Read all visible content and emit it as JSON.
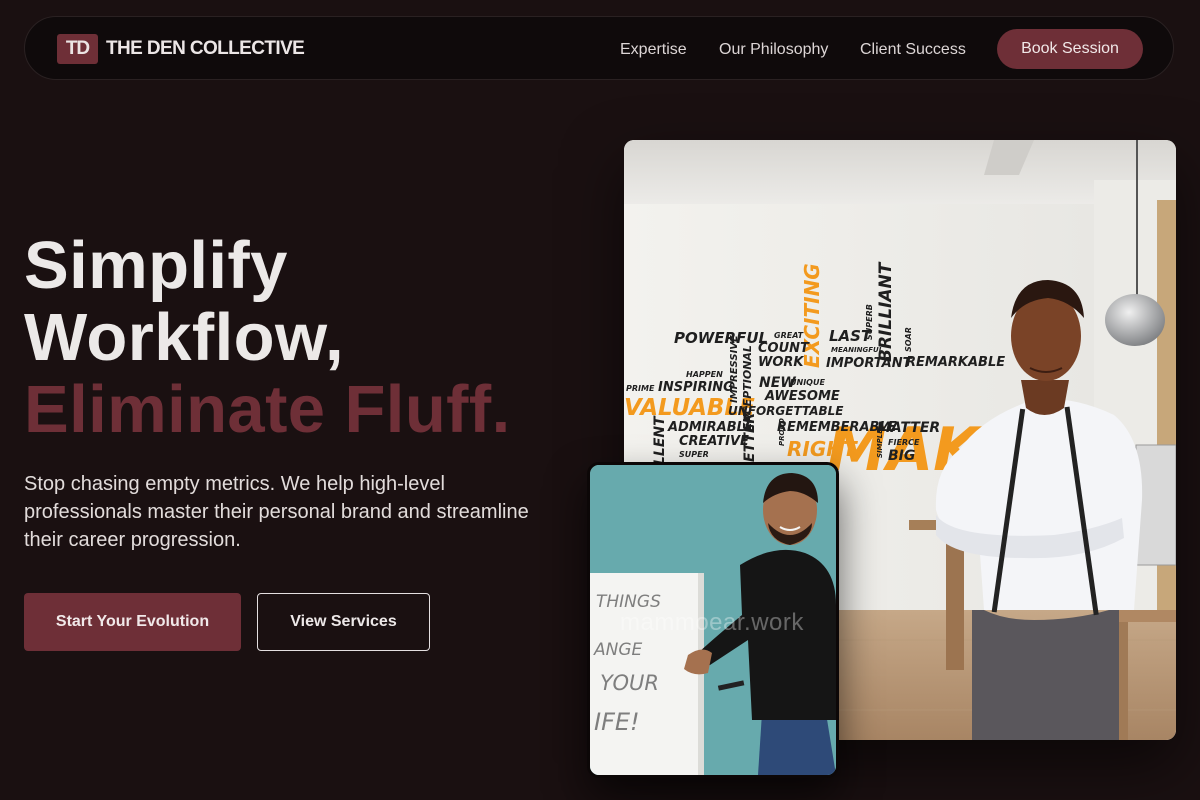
{
  "brand": {
    "badge": "TD",
    "name": "THE DEN COLLECTIVE"
  },
  "nav": {
    "links": [
      "Expertise",
      "Our Philosophy",
      "Client Success"
    ],
    "cta": "Book Session"
  },
  "hero": {
    "headline": [
      "Simplify",
      "Workflow,",
      "Eliminate Fluff."
    ],
    "subtext": "Stop chasing empty metrics. We help high-level professionals master their personal brand and streamline their career progression.",
    "primary_button": "Start Your Evolution",
    "secondary_button": "View Services"
  },
  "wall_words": {
    "orange": [
      "EXCITING",
      "MAKE IT",
      "VALUABLE",
      "RIGHT"
    ],
    "dark": [
      "POWERFUL",
      "GREAT",
      "COUNT",
      "WORK",
      "LAST",
      "MEANINGFUL",
      "IMPORTANT",
      "BRILLIANT",
      "SUPERB",
      "SOAR",
      "REMARKABLE",
      "HAPPEN",
      "PRIME",
      "INSPIRING",
      "IMPRESSIVE",
      "EXCEPTIONAL",
      "NEW",
      "UNIQUE",
      "AWESOME",
      "UNFORGETTABLE",
      "ADMIRABLE",
      "CREATIVE",
      "SUPER",
      "REMEMBERABLE",
      "MATTER",
      "SIMPLE",
      "FIERCE",
      "BIG",
      "PROUD",
      "LLENT",
      "ETTER"
    ]
  },
  "whiteboard_text": [
    "THINGS",
    "ANGE",
    "YOUR",
    "IFE!"
  ],
  "watermark": "mammoear.work",
  "colors": {
    "background": "#1a1011",
    "accent": "#6e2f37",
    "nav_bg": "#0f0a0b",
    "orange_word": "#f39a1e",
    "teal_backdrop": "#67aaad"
  }
}
